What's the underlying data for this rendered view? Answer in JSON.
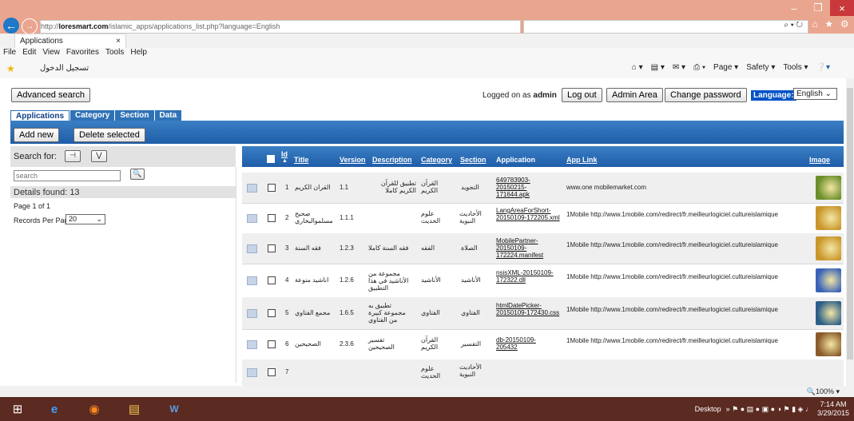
{
  "browser": {
    "url_prefix": "http://",
    "url_host": "loresmart.com",
    "url_path": "/islamic_apps/applications_list.php?language=English",
    "addr_tools": "⌕ ▾ ↻",
    "tab_title": "Applications",
    "tab_close": "×",
    "menu": [
      "File",
      "Edit",
      "View",
      "Favorites",
      "Tools",
      "Help"
    ],
    "fav_link": "تسجيل الدخول",
    "cmd": {
      "page": "Page ▾",
      "safety": "Safety ▾",
      "tools": "Tools ▾"
    },
    "zoom": "🔍100%  ▾"
  },
  "toolbar": {
    "advanced_search": "Advanced search",
    "logged_text": "Logged on as ",
    "user": "admin",
    "logout": "Log out",
    "admin_area": "Admin Area",
    "change_password": "Change password",
    "language_label": "Language:",
    "language_value": "English"
  },
  "tabs": [
    "Applications",
    "Category",
    "Section",
    "Data"
  ],
  "actions": {
    "add_new": "Add new",
    "delete_selected": "Delete selected"
  },
  "sidebar": {
    "search_for": "Search for:",
    "search_placeholder": "search",
    "details": "Details found: 13",
    "page_info": "Page 1 of 1",
    "records_label": "Records Per Page:",
    "records_value": "20"
  },
  "table": {
    "headers": {
      "id": "Id",
      "title": "Title",
      "version": "Version",
      "description": "Description",
      "category": "Category",
      "section": "Section",
      "application": "Application",
      "app_link": "App Link",
      "image": "Image"
    },
    "rows": [
      {
        "id": "1",
        "title": "القران الكريم",
        "version": "1.1",
        "description": "تطبيق للقرآن الكريم كاملا",
        "category": "القرآن الكريم",
        "section": "التجويد",
        "application": "649783903-20150215-171644.apk",
        "app_link": "www.one mobilemarket.com",
        "image_color": "#6b8f2a"
      },
      {
        "id": "2",
        "title": "صحيح مسلموالبخاري",
        "version": "1.1.1",
        "description": "",
        "category": "علوم الحديث",
        "section": "الأحاديث النبوية",
        "application": "LangAreaForShort-20150109-172205.xml",
        "app_link": "1Mobile http://www.1mobile.com/redirect/fr.meilleurlogiciel.cultureislamique",
        "image_color": "#c9962a"
      },
      {
        "id": "3",
        "title": "فقه السنة",
        "version": "1.2.3",
        "description": "فقه السنة كاملا",
        "category": "الفقه",
        "section": "الصلاة",
        "application": "MobilePartner-20150109-172224.manifest",
        "app_link": "1Mobile http://www.1mobile.com/redirect/fr.meilleurlogiciel.cultureislamique",
        "image_color": "#c9962a"
      },
      {
        "id": "4",
        "title": "اناشيد منوعة",
        "version": "1.2.6",
        "description": "مجموعة من الأناشيد في هذا التطبيق",
        "category": "الأناشيد",
        "section": "الأناشيد",
        "application": "nsisXML-20150109-172322.dll",
        "app_link": "1Mobile http://www.1mobile.com/redirect/fr.meilleurlogiciel.cultureislamique",
        "image_color": "#3a63b8"
      },
      {
        "id": "5",
        "title": "مجمع الفتاوي",
        "version": "1.6.5",
        "description": "تطبيق به مجموعة كبيرة من الفتاوي",
        "category": "الفتاوي",
        "section": "الفتاوي",
        "application": "htmlDatePicker-20150109-172430.css",
        "app_link": "1Mobile http://www.1mobile.com/redirect/fr.meilleurlogiciel.cultureislamique",
        "image_color": "#2c5e88"
      },
      {
        "id": "6",
        "title": "الصحيحين",
        "version": "2.3.6",
        "description": "تفسير الصحيحين",
        "category": "القرآن الكريم",
        "section": "التفسير",
        "application": "db-20150109-205432",
        "app_link": "1Mobile http://www.1mobile.com/redirect/fr.meilleurlogiciel.cultureislamique",
        "image_color": "#8a5a2a"
      },
      {
        "id": "7",
        "title": "",
        "version": "",
        "description": "",
        "category": "علوم الحديث",
        "section": "الأحاديث النبوية",
        "application": "",
        "app_link": "",
        "image_color": ""
      }
    ]
  },
  "taskbar": {
    "desktop": "Desktop",
    "time": "7:14 AM",
    "date": "3/29/2015"
  }
}
